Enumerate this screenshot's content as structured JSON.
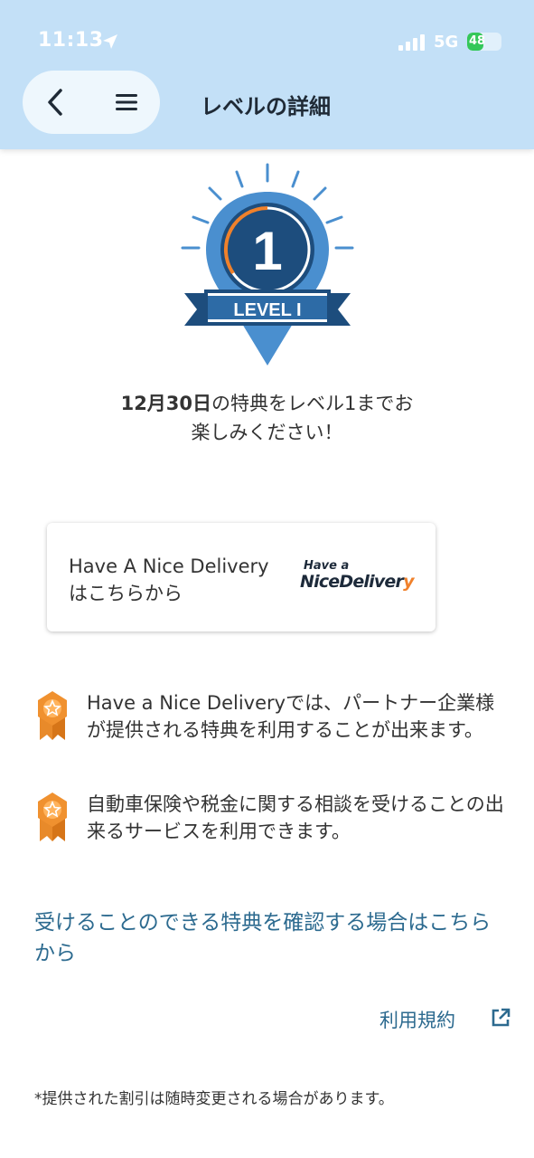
{
  "status_bar": {
    "time": "11:13",
    "network": "5G",
    "battery": "48",
    "battery_level_percent": 48
  },
  "header": {
    "title": "レベルの詳細",
    "back_icon": "chevron-left-icon",
    "menu_icon": "hamburger-menu-icon"
  },
  "badge": {
    "number": "1",
    "label": "LEVEL I",
    "colors": {
      "primary": "#4a8fcf",
      "dark": "#1d4d7d",
      "ring": "#f0812b"
    }
  },
  "promo": {
    "date": "12月30日",
    "line1_rest": "の特典をレベル1までお",
    "line2": "楽しみください！"
  },
  "card": {
    "line1": "Have A Nice Delivery",
    "line2": "はこちらから",
    "logo_small": "Have a",
    "logo_main": "NiceDeliver",
    "logo_accent": "y"
  },
  "benefits": [
    {
      "icon": "award-ribbon-icon",
      "text": "Have a Nice Deliveryでは、パートナー企業様が提供される特典を利用することが出来ます。"
    },
    {
      "icon": "award-ribbon-icon",
      "text": "自動車保険や税金に関する相談を受けることの出来るサービスを利用できます。"
    }
  ],
  "link_benefits": "受けることのできる特典を確認する場合はこちらから",
  "terms": {
    "label": "利用規約",
    "icon": "external-link-icon"
  },
  "footnote": "*提供された割引は随時変更される場合があります。",
  "colors": {
    "header_bg": "#c3e0f7",
    "link": "#2c6a8f",
    "accent_orange": "#f0812b"
  }
}
